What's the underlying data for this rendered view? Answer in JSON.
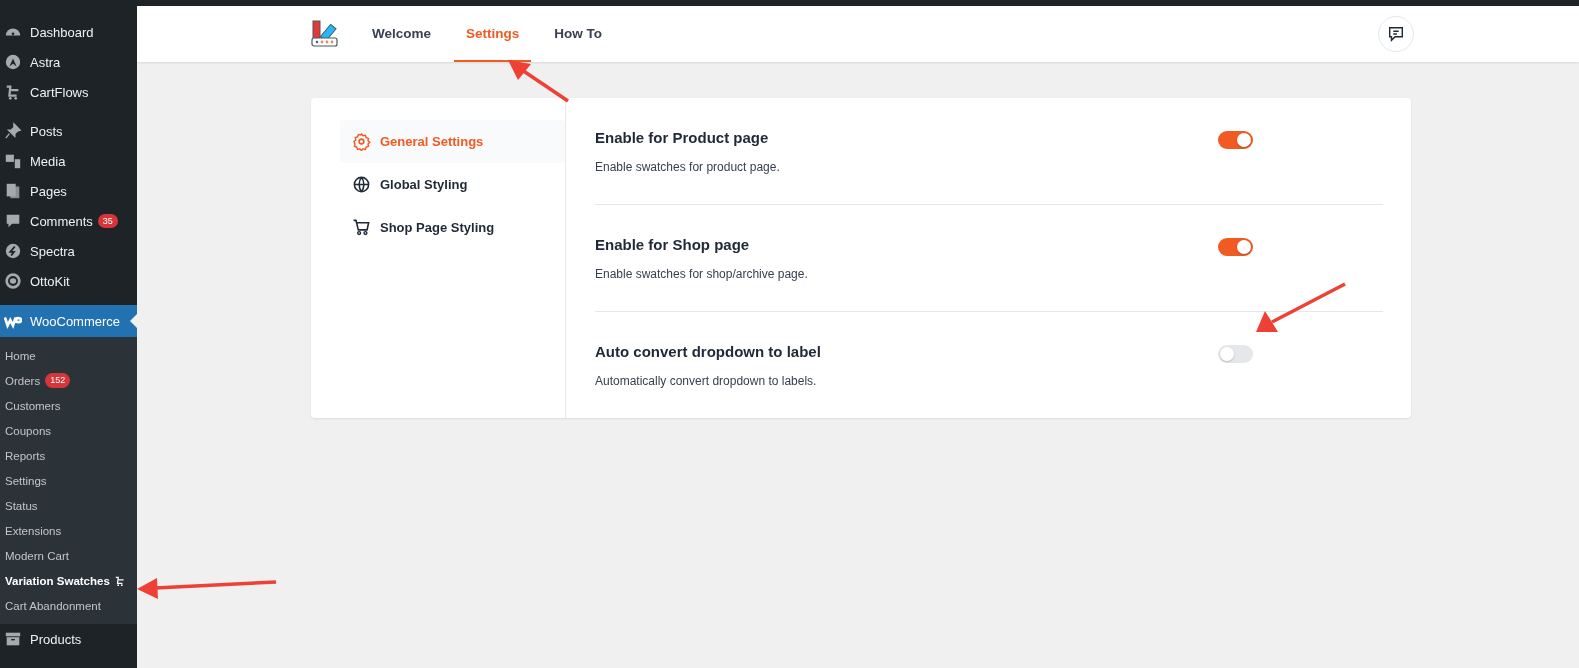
{
  "sidebar": {
    "groups": [
      {
        "items": [
          {
            "label": "Dashboard",
            "selected": false
          },
          {
            "label": "Astra",
            "selected": false
          },
          {
            "label": "CartFlows",
            "selected": false
          }
        ]
      },
      {
        "items": [
          {
            "label": "Posts",
            "selected": false
          },
          {
            "label": "Media",
            "selected": false
          },
          {
            "label": "Pages",
            "selected": false
          },
          {
            "label": "Comments",
            "selected": false,
            "badge": "35"
          },
          {
            "label": "Spectra",
            "selected": false
          },
          {
            "label": "OttoKit",
            "selected": false
          }
        ]
      },
      {
        "items": [
          {
            "label": "WooCommerce",
            "selected": true,
            "children": [
              {
                "label": "Home",
                "selected": false
              },
              {
                "label": "Orders",
                "selected": false,
                "badge": "152"
              },
              {
                "label": "Customers",
                "selected": false
              },
              {
                "label": "Coupons",
                "selected": false
              },
              {
                "label": "Reports",
                "selected": false
              },
              {
                "label": "Settings",
                "selected": false
              },
              {
                "label": "Status",
                "selected": false
              },
              {
                "label": "Extensions",
                "selected": false
              },
              {
                "label": "Modern Cart",
                "selected": false
              },
              {
                "label": "Variation Swatches",
                "selected": true,
                "icon": true
              },
              {
                "label": "Cart Abandonment",
                "selected": false
              }
            ]
          },
          {
            "label": "Products",
            "selected": false
          }
        ]
      }
    ]
  },
  "header": {
    "tabs": [
      {
        "label": "Welcome",
        "selected": false
      },
      {
        "label": "Settings",
        "selected": true
      },
      {
        "label": "How To",
        "selected": false
      }
    ]
  },
  "settings_nav": [
    {
      "label": "General Settings",
      "selected": true
    },
    {
      "label": "Global Styling",
      "selected": false
    },
    {
      "label": "Shop Page Styling",
      "selected": false
    }
  ],
  "settings": [
    {
      "title": "Enable for Product page",
      "description": "Enable swatches for product page.",
      "on": true
    },
    {
      "title": "Enable for Shop page",
      "description": "Enable swatches for shop/archive page.",
      "on": true
    },
    {
      "title": "Auto convert dropdown to label",
      "description": "Automatically convert dropdown to labels.",
      "on": false
    }
  ]
}
